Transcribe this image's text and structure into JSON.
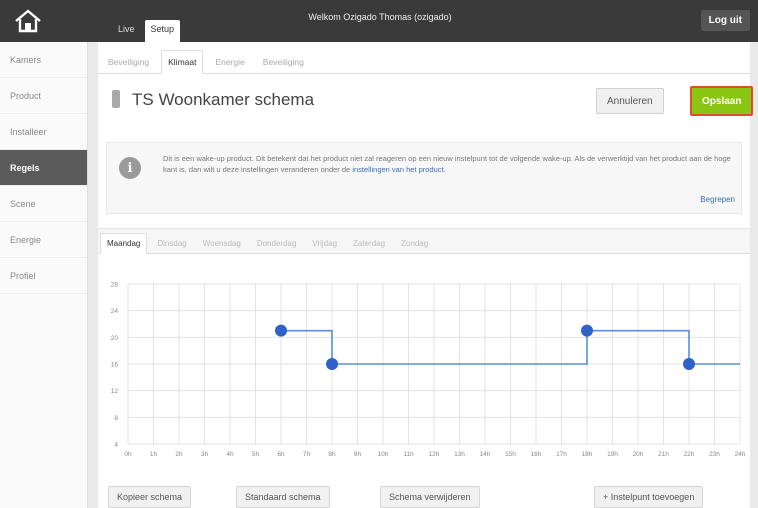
{
  "header": {
    "welcome": "Welkom Ozigado Thomas (ozigado)",
    "logout_label": "Log uit",
    "modes": [
      {
        "label": "Live"
      },
      {
        "label": "Setup"
      }
    ]
  },
  "sidebar": {
    "items": [
      {
        "label": "Kamers"
      },
      {
        "label": "Product"
      },
      {
        "label": "Installeer"
      },
      {
        "label": "Regels"
      },
      {
        "label": "Scene"
      },
      {
        "label": "Energie"
      },
      {
        "label": "Profiel"
      }
    ]
  },
  "subtabs": [
    {
      "label": "Beveiliging"
    },
    {
      "label": "Klimaat"
    },
    {
      "label": "Energie"
    },
    {
      "label": "Beveiliging"
    }
  ],
  "page": {
    "title": "TS Woonkamer schema",
    "cancel_label": "Annuleren",
    "save_label": "Opslaan"
  },
  "info": {
    "text": "Dit is een wake-up product. Dit betekent dat het product niet zal reageren op een nieuw instelpunt tot de volgende wake-up. Als de verwerktijd van het product aan de hoge kant is, dan wilt u deze instellingen veranderen onder de",
    "link": "instellingen van het product.",
    "ok_label": "Begrepen"
  },
  "days": [
    {
      "label": "Maandag"
    },
    {
      "label": "Dinsdag"
    },
    {
      "label": "Woensdag"
    },
    {
      "label": "Donderdag"
    },
    {
      "label": "Vrijdag"
    },
    {
      "label": "Zaterdag"
    },
    {
      "label": "Zondag"
    }
  ],
  "buttons": {
    "copy_label": "Kopieer schema",
    "default_label": "Standaard schema",
    "delete_label": "Schema verwijderen",
    "add_label": "+ Instelpunt toevoegen"
  },
  "chart_data": {
    "type": "line",
    "step": true,
    "x_ticks": [
      "0h",
      "1h",
      "2h",
      "3h",
      "4h",
      "5h",
      "6h",
      "7h",
      "8h",
      "9h",
      "10h",
      "11h",
      "12h",
      "13h",
      "14h",
      "15h",
      "16h",
      "17h",
      "18h",
      "19h",
      "20h",
      "21h",
      "22h",
      "23h",
      "24h"
    ],
    "y_ticks": [
      4,
      8,
      12,
      16,
      20,
      24,
      28
    ],
    "xlim": [
      0,
      24
    ],
    "ylim": [
      4,
      28
    ],
    "grid": true,
    "points": [
      {
        "x": 6,
        "y": 21
      },
      {
        "x": 8,
        "y": 16
      },
      {
        "x": 18,
        "y": 21
      },
      {
        "x": 22,
        "y": 16
      }
    ],
    "line_color": "#5b8ed6",
    "point_color": "#2f62c9"
  },
  "colors": {
    "accent_save": "#8bc514",
    "save_border": "#d9502a",
    "active_nav": "#5a5a5a"
  }
}
